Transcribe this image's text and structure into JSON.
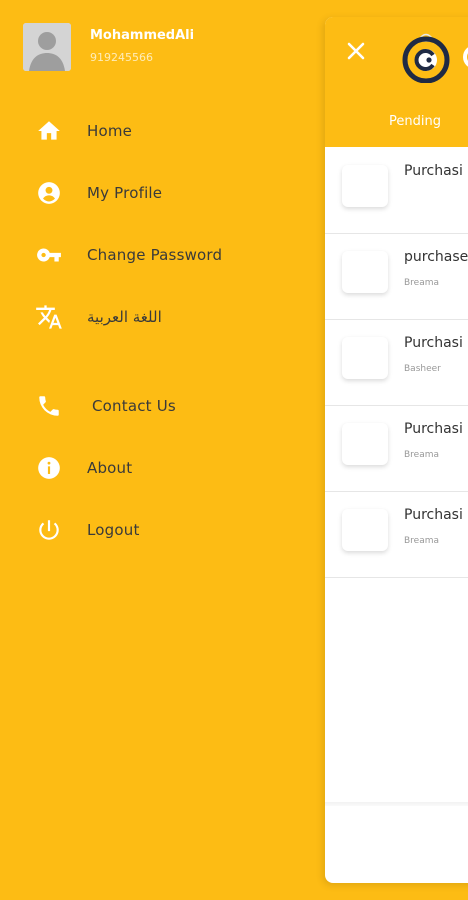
{
  "drawer": {
    "user": {
      "name": "MohammedAli",
      "phone": "919245566"
    },
    "menu": [
      {
        "label": "Home",
        "icon": "home-icon"
      },
      {
        "label": "My Profile",
        "icon": "account-circle-icon"
      },
      {
        "label": "Change Password",
        "icon": "key-icon"
      },
      {
        "label": "اللغة العربية",
        "icon": "translate-icon"
      },
      {
        "label": "Contact Us",
        "icon": "phone-icon"
      },
      {
        "label": "About",
        "icon": "info-icon"
      },
      {
        "label": "Logout",
        "icon": "power-icon"
      }
    ]
  },
  "panel": {
    "tab": "Pending",
    "orders": [
      {
        "title": "Purchasi",
        "sub": ""
      },
      {
        "title": "purchase",
        "sub": "Breama"
      },
      {
        "title": "Purchasi",
        "sub": "Basheer"
      },
      {
        "title": "Purchasi",
        "sub": "Breama"
      },
      {
        "title": "Purchasi",
        "sub": "Breama"
      }
    ]
  },
  "colors": {
    "brand": "#FDBC14",
    "text_dark": "#3a3a3a",
    "logo": "#1f2a44"
  }
}
